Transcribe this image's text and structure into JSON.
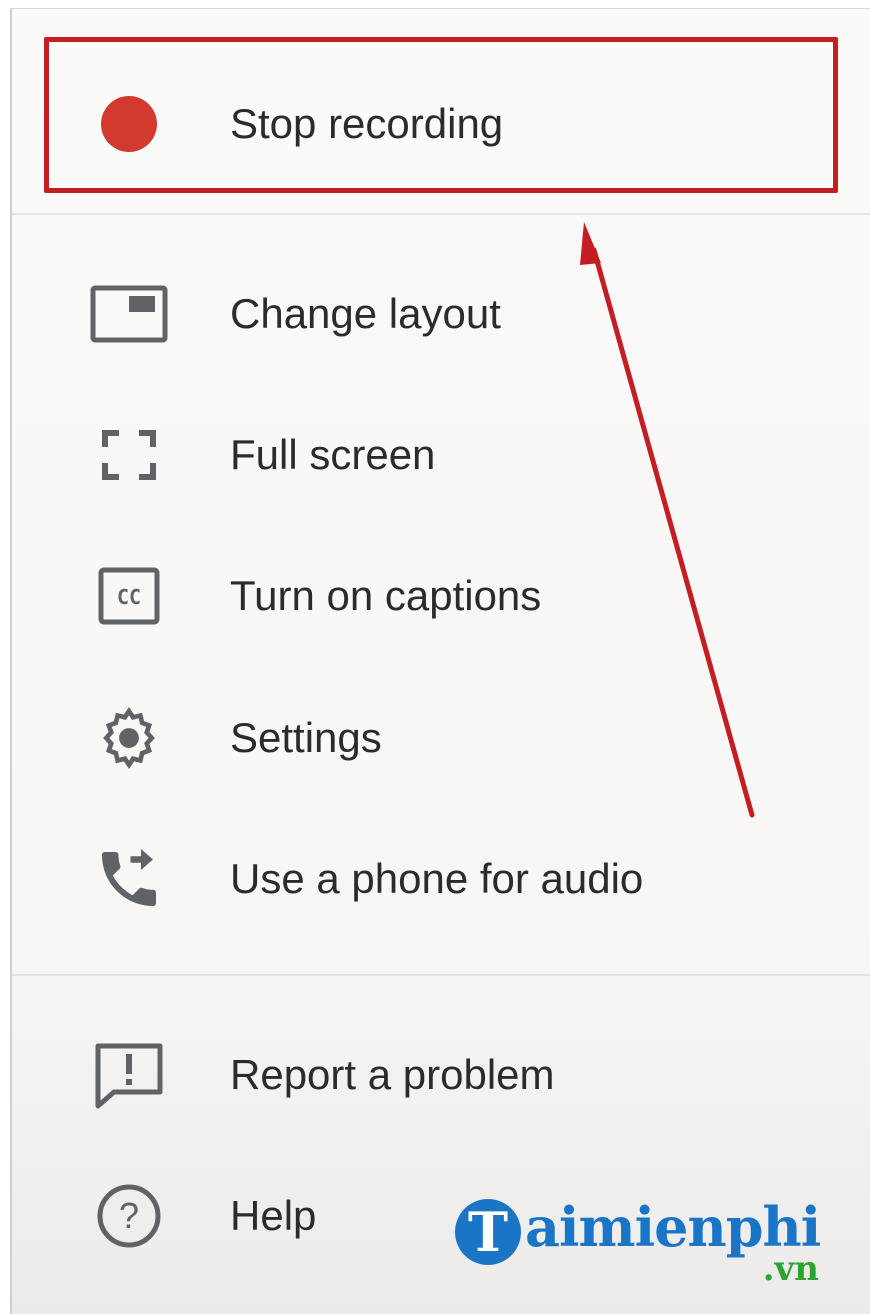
{
  "menu": {
    "items": [
      {
        "icon": "record-dot-icon",
        "label": "Stop recording"
      },
      {
        "icon": "change-layout-icon",
        "label": "Change layout"
      },
      {
        "icon": "full-screen-icon",
        "label": "Full screen"
      },
      {
        "icon": "captions-icon",
        "label": "Turn on captions"
      },
      {
        "icon": "gear-icon",
        "label": "Settings"
      },
      {
        "icon": "phone-forward-icon",
        "label": "Use a phone for audio"
      },
      {
        "icon": "report-problem-icon",
        "label": "Report a problem"
      },
      {
        "icon": "help-icon",
        "label": "Help"
      }
    ],
    "highlighted_item": "Stop recording"
  },
  "colors": {
    "record": "#d23a2f",
    "annotation": "#c41e24",
    "icon": "#5f6368",
    "logo_blue": "#1b75c7",
    "logo_green": "#2aa52e"
  },
  "watermark": {
    "brand": "aimienphi",
    "initial": "T",
    "suffix": ".vn"
  }
}
